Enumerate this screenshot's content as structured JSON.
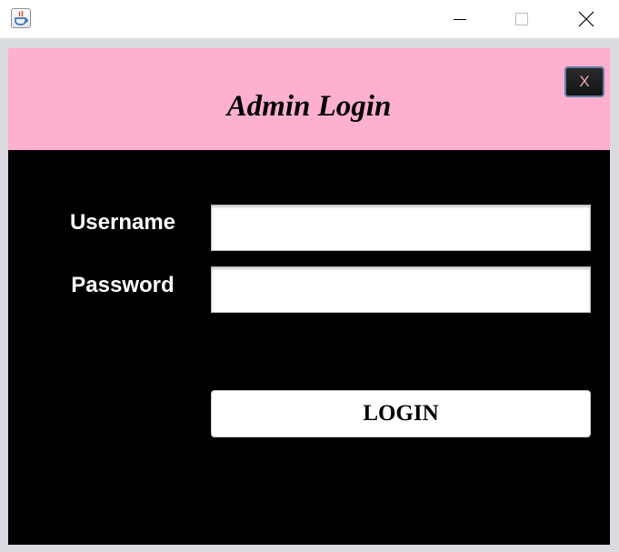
{
  "window": {
    "app_icon": "java-cup-icon",
    "controls": {
      "minimize": "minimize-icon",
      "maximize": "maximize-icon",
      "close": "close-icon"
    }
  },
  "header": {
    "title": "Admin Login",
    "background": "#ffb0d0",
    "close_label": "X",
    "close_label_color": "#f2a6c0"
  },
  "form": {
    "username_label": "Username",
    "username_value": "",
    "password_label": "Password",
    "password_value": "",
    "login_label": "LOGIN"
  },
  "colors": {
    "panel_background": "#000000",
    "label_text": "#ffffff"
  }
}
